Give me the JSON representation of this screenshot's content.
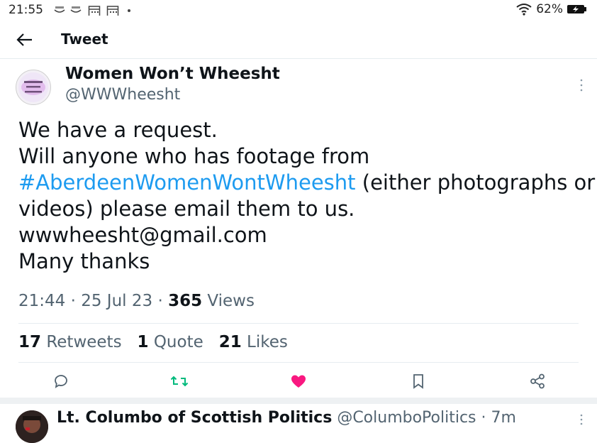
{
  "status_bar": {
    "time": "21:55",
    "battery": "62%",
    "icons": [
      "photos-icon",
      "photos-icon",
      "calendar-icon",
      "calendar-icon",
      "dot-icon",
      "wifi-icon",
      "battery-icon"
    ]
  },
  "header": {
    "title": "Tweet"
  },
  "tweet": {
    "author_name": "Women Won’t Wheesht",
    "author_handle": "@WWWheesht",
    "text": {
      "line1": "We have a request.",
      "line2": "Will anyone who has footage from",
      "hashtag": "#AberdeenWomenWontWheesht",
      "line3_rest": " (either photographs or",
      "line4": "videos) please email them to us.",
      "line5": "wwwheesht@gmail.com",
      "line6": "Many thanks"
    },
    "time": "21:44",
    "date": "25 Jul 23",
    "views_count": "365",
    "views_label": "Views",
    "retweets_count": "17",
    "retweets_label": "Retweets",
    "quotes_count": "1",
    "quotes_label": "Quote",
    "likes_count": "21",
    "likes_label": "Likes"
  },
  "actions": [
    "reply-icon",
    "retweet-icon",
    "like-icon",
    "bookmark-icon",
    "share-icon"
  ],
  "colors": {
    "accent": "#1d9bf0",
    "retweet": "#00ba7c",
    "like": "#f91880",
    "muted": "#536471"
  },
  "reply": {
    "author_name": "Lt. Columbo of Scottish Politics",
    "handle": "@ColumboPolitics",
    "time": "7m"
  }
}
